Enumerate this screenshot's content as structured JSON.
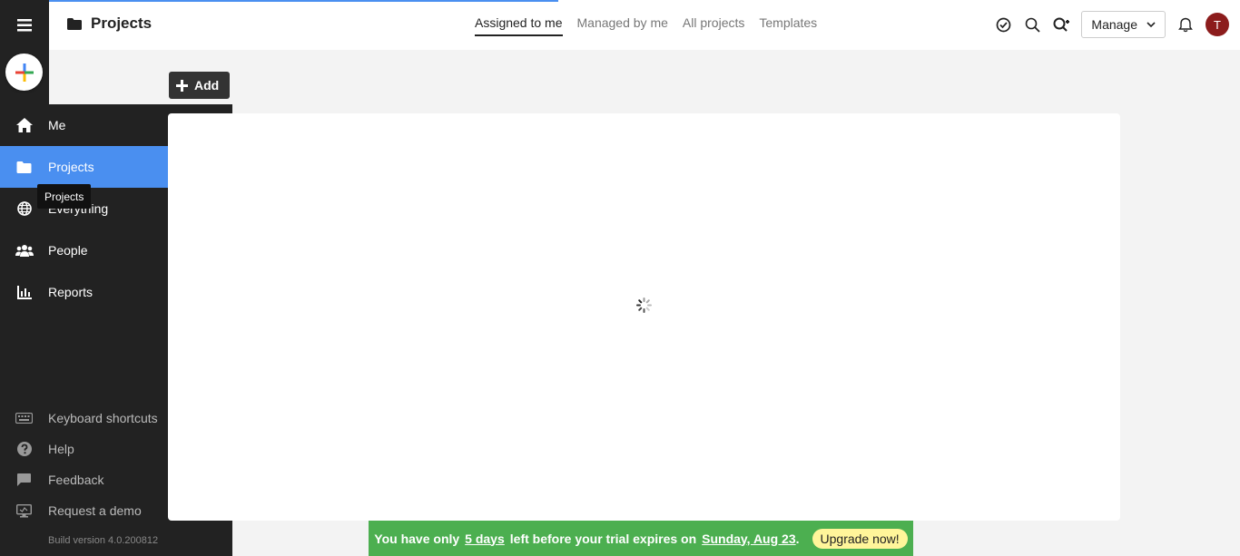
{
  "header": {
    "title": "Projects",
    "tabs": [
      {
        "label": "Assigned to me",
        "active": true
      },
      {
        "label": "Managed by me",
        "active": false
      },
      {
        "label": "All projects",
        "active": false
      },
      {
        "label": "Templates",
        "active": false
      }
    ],
    "manage_label": "Manage",
    "avatar_initial": "T"
  },
  "sidebar": {
    "items": [
      {
        "label": "Me",
        "icon": "home-icon"
      },
      {
        "label": "Projects",
        "icon": "folder-icon"
      },
      {
        "label": "Everything",
        "icon": "globe-icon"
      },
      {
        "label": "People",
        "icon": "people-icon"
      },
      {
        "label": "Reports",
        "icon": "chart-icon"
      }
    ],
    "active_index": 1,
    "bottom": [
      {
        "label": "Keyboard shortcuts",
        "icon": "keyboard-icon"
      },
      {
        "label": "Help",
        "icon": "help-icon"
      },
      {
        "label": "Feedback",
        "icon": "feedback-icon"
      },
      {
        "label": "Request a demo",
        "icon": "monitor-icon"
      }
    ],
    "build_version": "Build version 4.0.200812",
    "tooltip": "Projects"
  },
  "main": {
    "add_label": "Add"
  },
  "banner": {
    "prefix": "You have only",
    "days": "5 days",
    "middle": "left before your trial expires on",
    "date": "Sunday, Aug 23",
    "suffix": ".",
    "upgrade_label": "Upgrade now!"
  },
  "colors": {
    "accent": "#4a8ff0",
    "sidebar": "#222222",
    "banner": "#4caf50",
    "upgrade": "#fff59a",
    "avatar": "#8c1c1c"
  }
}
